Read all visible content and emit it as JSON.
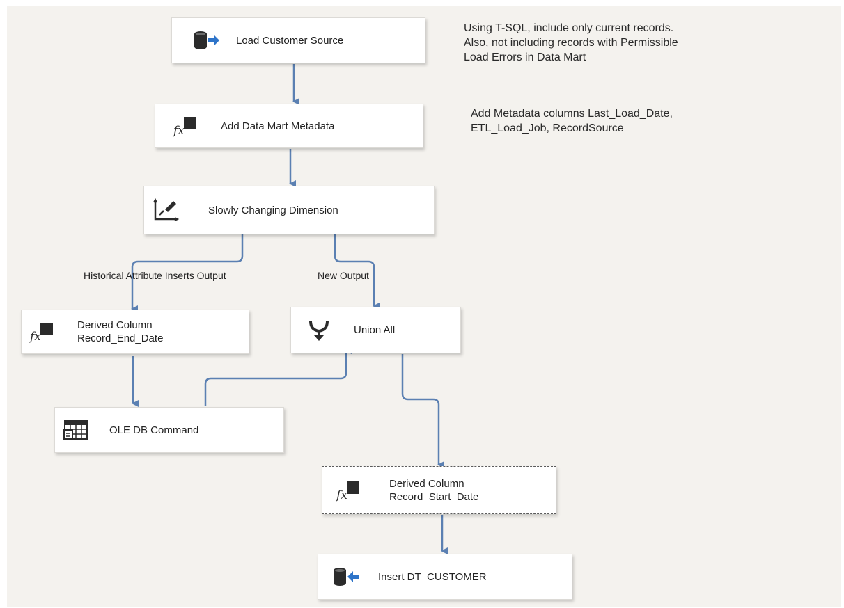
{
  "components": {
    "load_customer_source": {
      "label": "Load Customer Source",
      "icon": "source-db-icon"
    },
    "add_data_mart_metadata": {
      "label": "Add Data Mart Metadata",
      "icon": "fx-icon"
    },
    "slowly_changing_dimension": {
      "label": "Slowly Changing Dimension",
      "icon": "scd-icon"
    },
    "derived_column_end": {
      "line1": "Derived Column",
      "line2": "Record_End_Date",
      "icon": "fx-icon"
    },
    "union_all": {
      "label": "Union All",
      "icon": "union-icon"
    },
    "ole_db_command": {
      "label": "OLE DB Command",
      "icon": "table-command-icon"
    },
    "derived_column_start": {
      "line1": "Derived Column",
      "line2": "Record_Start_Date",
      "icon": "fx-icon"
    },
    "insert_dt_customer": {
      "label": "Insert DT_CUSTOMER",
      "icon": "destination-db-icon"
    }
  },
  "annotations": {
    "note1": {
      "line1": "Using T-SQL, include only current records.",
      "line2": "Also, not including records with Permissible",
      "line3": "Load Errors in Data Mart"
    },
    "note2": {
      "line1": "Add Metadata columns Last_Load_Date,",
      "line2": "ETL_Load_Job, RecordSource"
    }
  },
  "path_labels": {
    "historical": "Historical Attribute Inserts Output",
    "new_output": "New Output"
  },
  "colors": {
    "canvas": "#f4f2ee",
    "arrow": "#5b80b2",
    "icon_dark": "#2b2b2b",
    "icon_blue": "#2e74c9"
  }
}
